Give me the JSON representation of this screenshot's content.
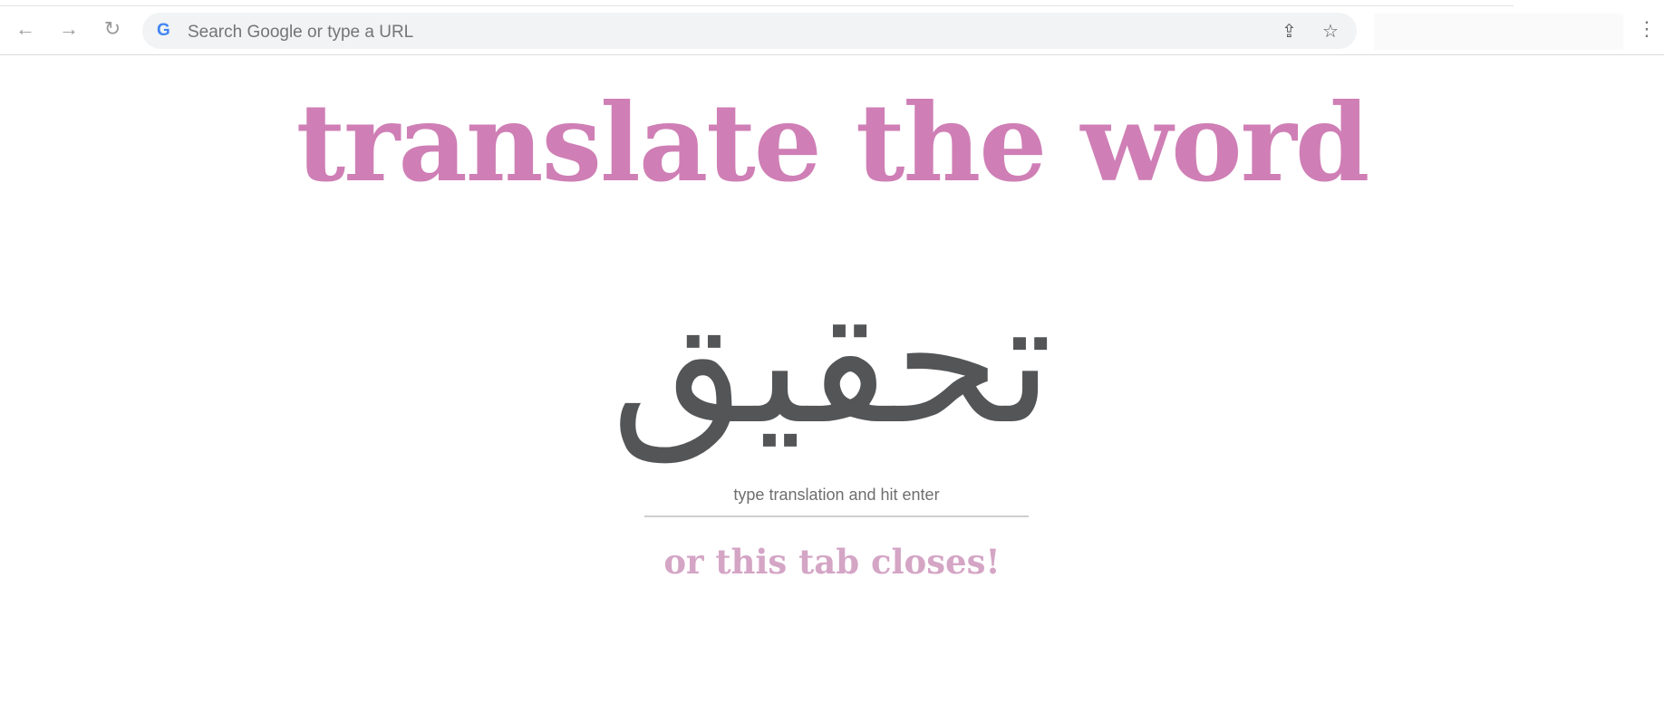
{
  "browser": {
    "address_placeholder": "Search Google or type a URL",
    "icons": [
      "back-arrow-icon",
      "forward-arrow-icon",
      "reload-icon",
      "google-icon",
      "share-icon",
      "star-icon",
      "menu-icon"
    ]
  },
  "page": {
    "heading": "translate the word",
    "word": "تحقيق",
    "input_placeholder": "type translation and hit enter",
    "warning": "or this tab closes!"
  },
  "colors": {
    "heading": "#cf7fb5",
    "word": "#545557",
    "warning": "#d4a5c5"
  }
}
